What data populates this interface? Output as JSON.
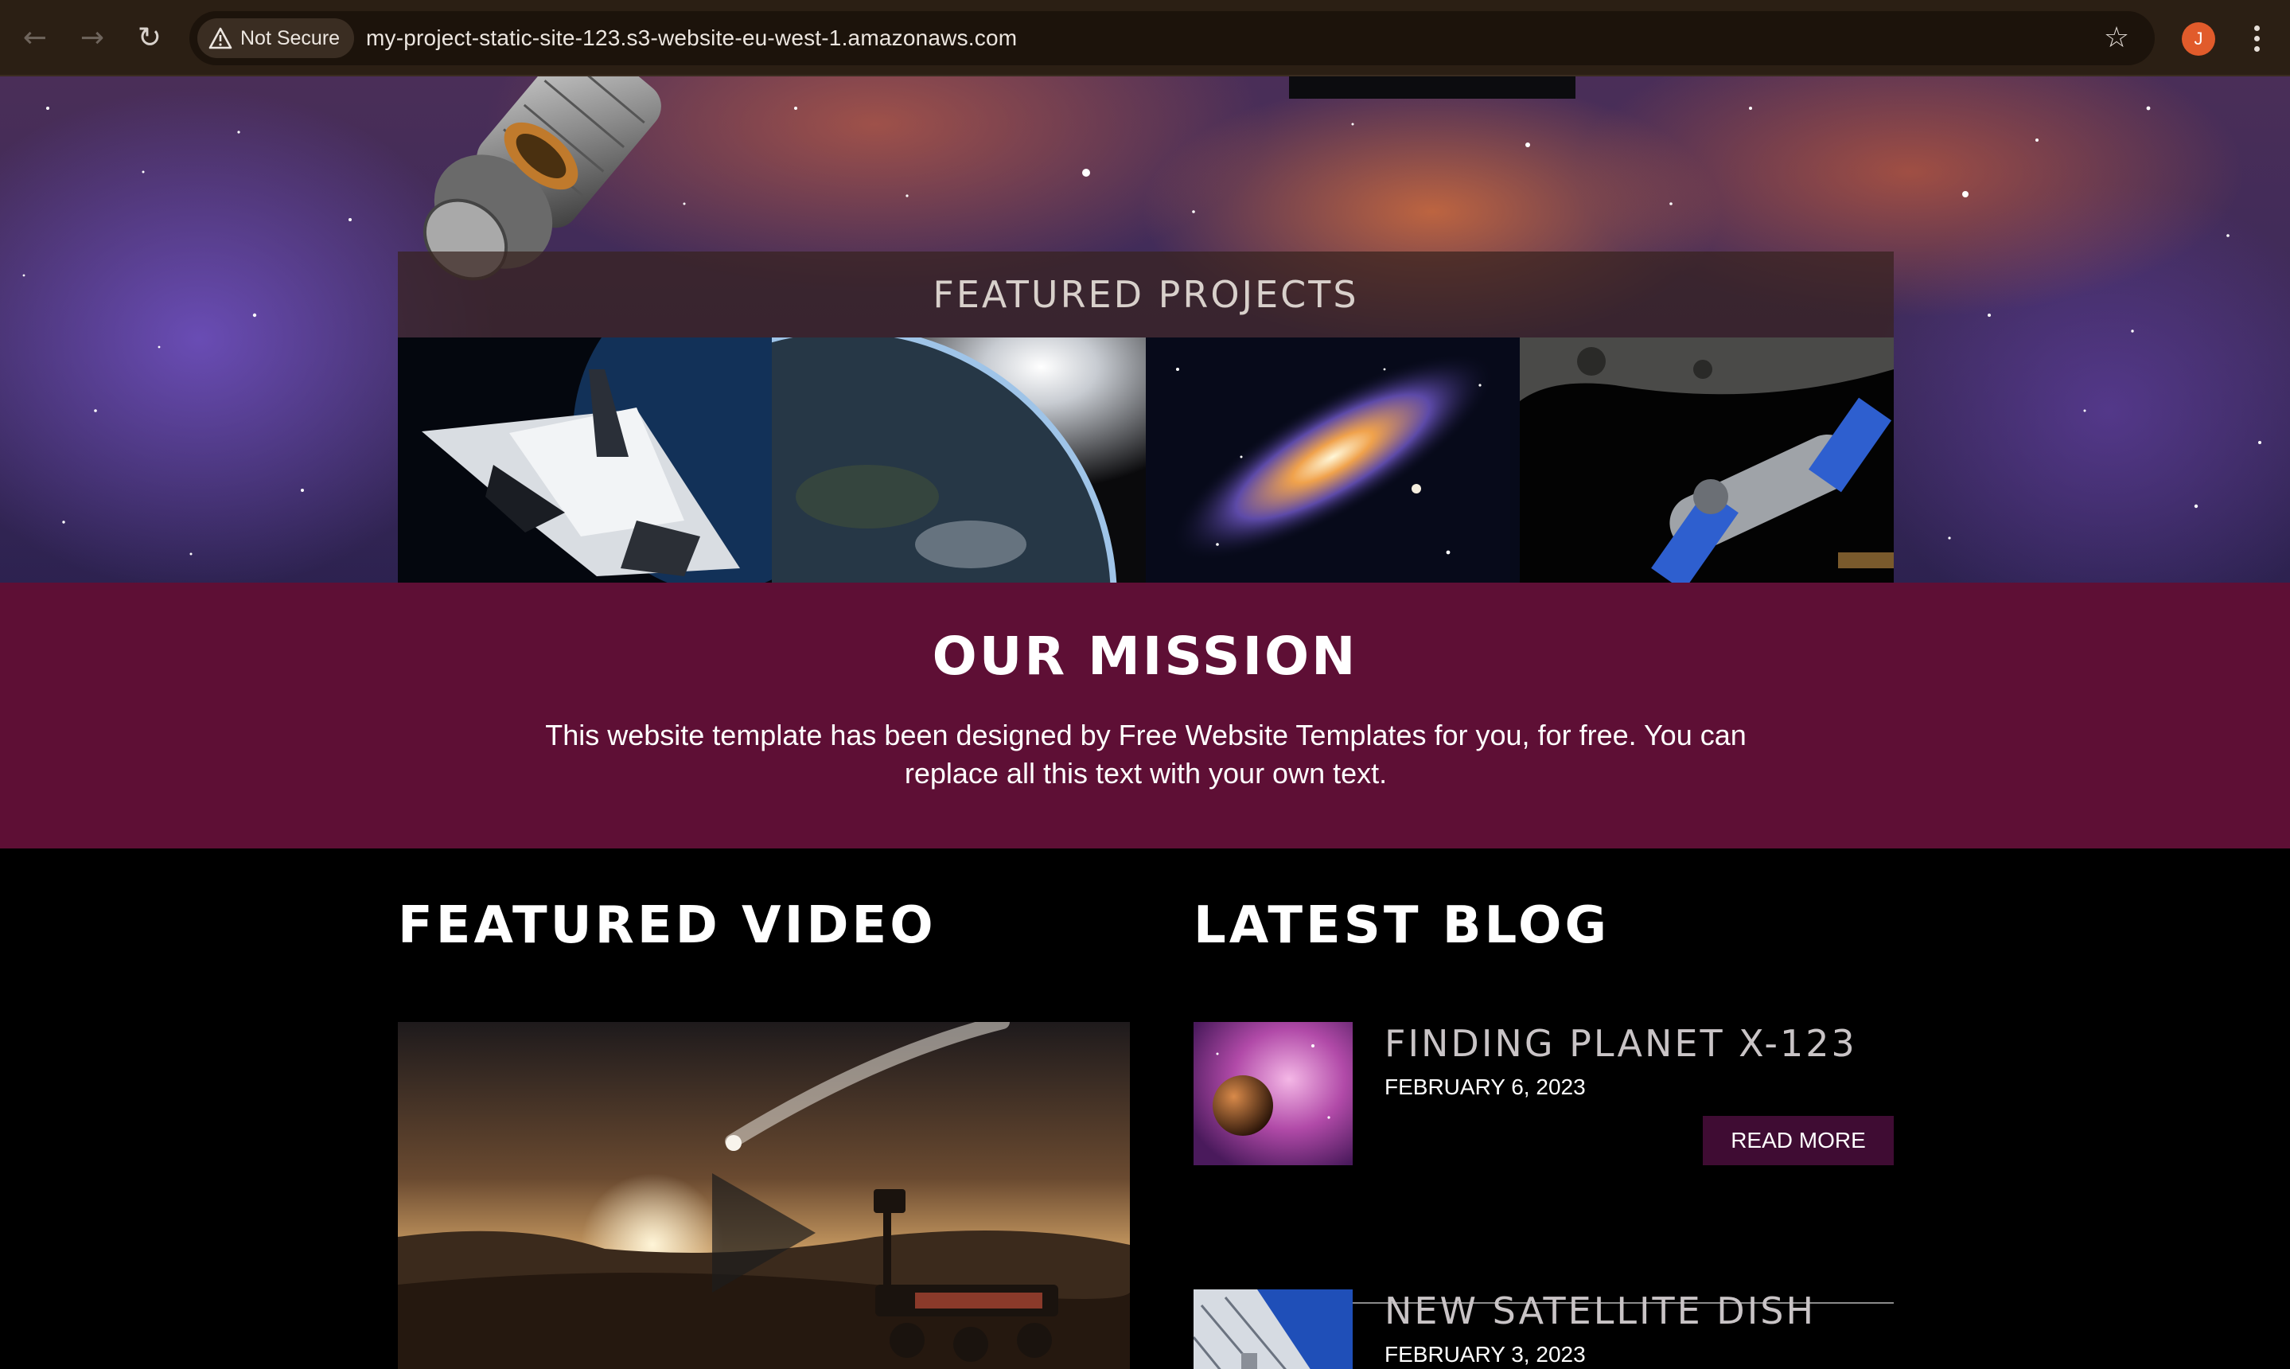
{
  "browser": {
    "security_label": "Not Secure",
    "url": "my-project-static-site-123.s3-website-eu-west-1.amazonaws.com",
    "avatar_initial": "J",
    "icons": [
      "back-icon",
      "forward-icon",
      "reload-icon",
      "warning-icon",
      "star-icon",
      "more-menu-icon"
    ]
  },
  "featured_projects": {
    "title": "FEATURED PROJECTS",
    "items": [
      "space-shuttle",
      "earth",
      "galaxy",
      "space-station"
    ]
  },
  "mission": {
    "title": "OUR MISSION",
    "text": "This website template has been designed by Free Website Templates for you, for free. You can replace all this text with your own text."
  },
  "featured_video": {
    "title": "FEATURED VIDEO"
  },
  "latest_blog": {
    "title": "LATEST BLOG",
    "posts": [
      {
        "title": "FINDING PLANET X-123",
        "date": "FEBRUARY 6, 2023",
        "button": "READ MORE"
      },
      {
        "title": "NEW SATELLITE DISH",
        "date": "FEBRUARY 3, 2023"
      }
    ]
  },
  "colors": {
    "chrome_bg": "#2b1f14",
    "mission_bg": "#5e0f35",
    "read_more_bg": "#3f0c33"
  }
}
